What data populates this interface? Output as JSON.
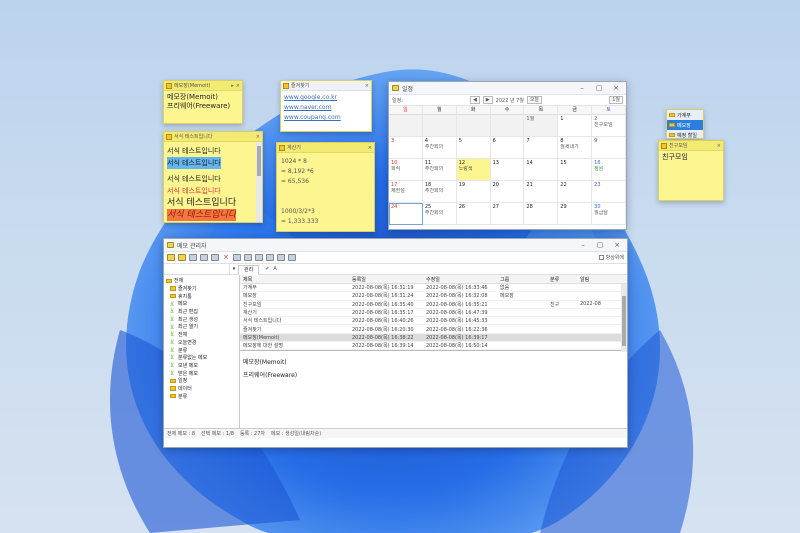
{
  "memo_mobile": {
    "title": "메모장(Memoit)",
    "lines": [
      "메모장(Memoit)",
      "프리웨어(Freeware)"
    ]
  },
  "memo_links": {
    "title": "즐겨찾기",
    "links": [
      "www.google.co.kr",
      "www.naver.com",
      "www.coupang.com"
    ]
  },
  "memo_calc": {
    "title": "계산기",
    "lines": [
      "1024 * 8",
      "= 8,192 *6",
      "= 65,536",
      "",
      "",
      "1000/3/2*3",
      "= 1,333.333"
    ]
  },
  "memo_styles": {
    "title": "서식 테스트입니다",
    "lines": [
      "서식 테스트입니다",
      "서식 테스트입니다",
      "서식 테스트입니다",
      "서식 테스트입니다",
      "서식 테스트입니다",
      "서식 테스트입니다"
    ],
    "colors": [
      "#222222",
      "#222222",
      "#222222",
      "#dd3333",
      "#222222",
      "#222222"
    ]
  },
  "memo_list": {
    "items": [
      "가계부",
      "메모장",
      "예정 할일"
    ]
  },
  "memo_friends": {
    "title": "친구모임",
    "lines": [
      "친구모임"
    ]
  },
  "calendar": {
    "title": "일정",
    "nav_label": "2022 년 7월",
    "today_btn": "오늘",
    "view_btn": "1월",
    "prev": "◀",
    "next": "▶",
    "weekdays": [
      "일",
      "월",
      "화",
      "수",
      "목",
      "금",
      "토"
    ],
    "weeks": [
      [
        {
          "d": "",
          "e": ""
        },
        {
          "d": "",
          "e": ""
        },
        {
          "d": "",
          "e": ""
        },
        {
          "d": "",
          "e": ""
        },
        {
          "d": "",
          "e": "1월"
        },
        {
          "d": "1",
          "e": ""
        },
        {
          "d": "2",
          "e": "친구모임"
        }
      ],
      [
        {
          "d": "3",
          "e": ""
        },
        {
          "d": "4",
          "e": "주간회의"
        },
        {
          "d": "5",
          "e": ""
        },
        {
          "d": "6",
          "e": ""
        },
        {
          "d": "7",
          "e": ""
        },
        {
          "d": "8",
          "e": "월세내기"
        },
        {
          "d": "9",
          "e": ""
        }
      ],
      [
        {
          "d": "10",
          "e": "회식"
        },
        {
          "d": "11",
          "e": "주간회의"
        },
        {
          "d": "12",
          "e": "노랑색"
        },
        {
          "d": "13",
          "e": ""
        },
        {
          "d": "14",
          "e": ""
        },
        {
          "d": "15",
          "e": ""
        },
        {
          "d": "16",
          "e": "정원"
        }
      ],
      [
        {
          "d": "17",
          "e": "제헌절"
        },
        {
          "d": "18",
          "e": "주간회의"
        },
        {
          "d": "19",
          "e": ""
        },
        {
          "d": "20",
          "e": ""
        },
        {
          "d": "21",
          "e": ""
        },
        {
          "d": "22",
          "e": ""
        },
        {
          "d": "23",
          "e": ""
        }
      ],
      [
        {
          "d": "24",
          "e": ""
        },
        {
          "d": "25",
          "e": "주간회의"
        },
        {
          "d": "26",
          "e": ""
        },
        {
          "d": "27",
          "e": ""
        },
        {
          "d": "28",
          "e": ""
        },
        {
          "d": "29",
          "e": ""
        },
        {
          "d": "30",
          "e": "월급날"
        }
      ]
    ]
  },
  "manager": {
    "title": "메모 관리자",
    "checkbox_label": "항상위에",
    "tab_label": "관리",
    "tree": [
      "전체",
      "즐겨찾기",
      "휴지통",
      "메모",
      "최근 편집",
      "최근 생성",
      "최근 열기",
      "전체",
      "오늘변경",
      "분류",
      "분류없는 메모",
      "보낸 메모",
      "받은 메모",
      "일정",
      "데이터",
      "분류"
    ],
    "columns": [
      "제목",
      "등록일",
      "수정일",
      "그룹",
      "분류",
      "알림"
    ],
    "rows": [
      {
        "title": "가계부",
        "created": "2022-08-08(목) 16:31:19",
        "modified": "2022-08-08(목) 16:33:46",
        "group": "없음",
        "cat": "",
        "alarm": ""
      },
      {
        "title": "메모장",
        "created": "2022-08-08(목) 16:31:24",
        "modified": "2022-08-08(목) 16:32:08",
        "group": "메모장",
        "cat": "",
        "alarm": ""
      },
      {
        "title": "친구모임",
        "created": "2022-08-08(목) 16:35:40",
        "modified": "2022-08-08(목) 16:35:21",
        "group": "",
        "cat": "친구",
        "alarm": "2022-08"
      },
      {
        "title": "계산기",
        "created": "2022-08-08(목) 16:35:17",
        "modified": "2022-08-08(목) 16:47:39",
        "group": "",
        "cat": "",
        "alarm": ""
      },
      {
        "title": "서식 테스트입니다",
        "created": "2022-08-08(목) 16:40:26",
        "modified": "2022-08-08(목) 16:45:33",
        "group": "",
        "cat": "",
        "alarm": ""
      },
      {
        "title": "즐겨찾기",
        "created": "2022-08-08(목) 16:20:30",
        "modified": "2022-08-08(목) 16:22:36",
        "group": "",
        "cat": "",
        "alarm": ""
      },
      {
        "title": "메모장(Memoit)",
        "created": "2022-08-08(목) 16:38:22",
        "modified": "2022-08-08(목) 16:39:17",
        "group": "",
        "cat": "",
        "alarm": ""
      },
      {
        "title": "메모장에 대한 설명",
        "created": "2022-08-08(목) 16:39:14",
        "modified": "2022-08-08(목) 16:50:14",
        "group": "",
        "cat": "",
        "alarm": ""
      }
    ],
    "preview": [
      "메모장(Memoit)",
      "프리웨어(Freeware)"
    ],
    "status": [
      "전체 메모 : 8",
      "선택 메모 : 1/8",
      "등록 : 27자",
      "메모 : 생성일(내림차순)"
    ]
  }
}
